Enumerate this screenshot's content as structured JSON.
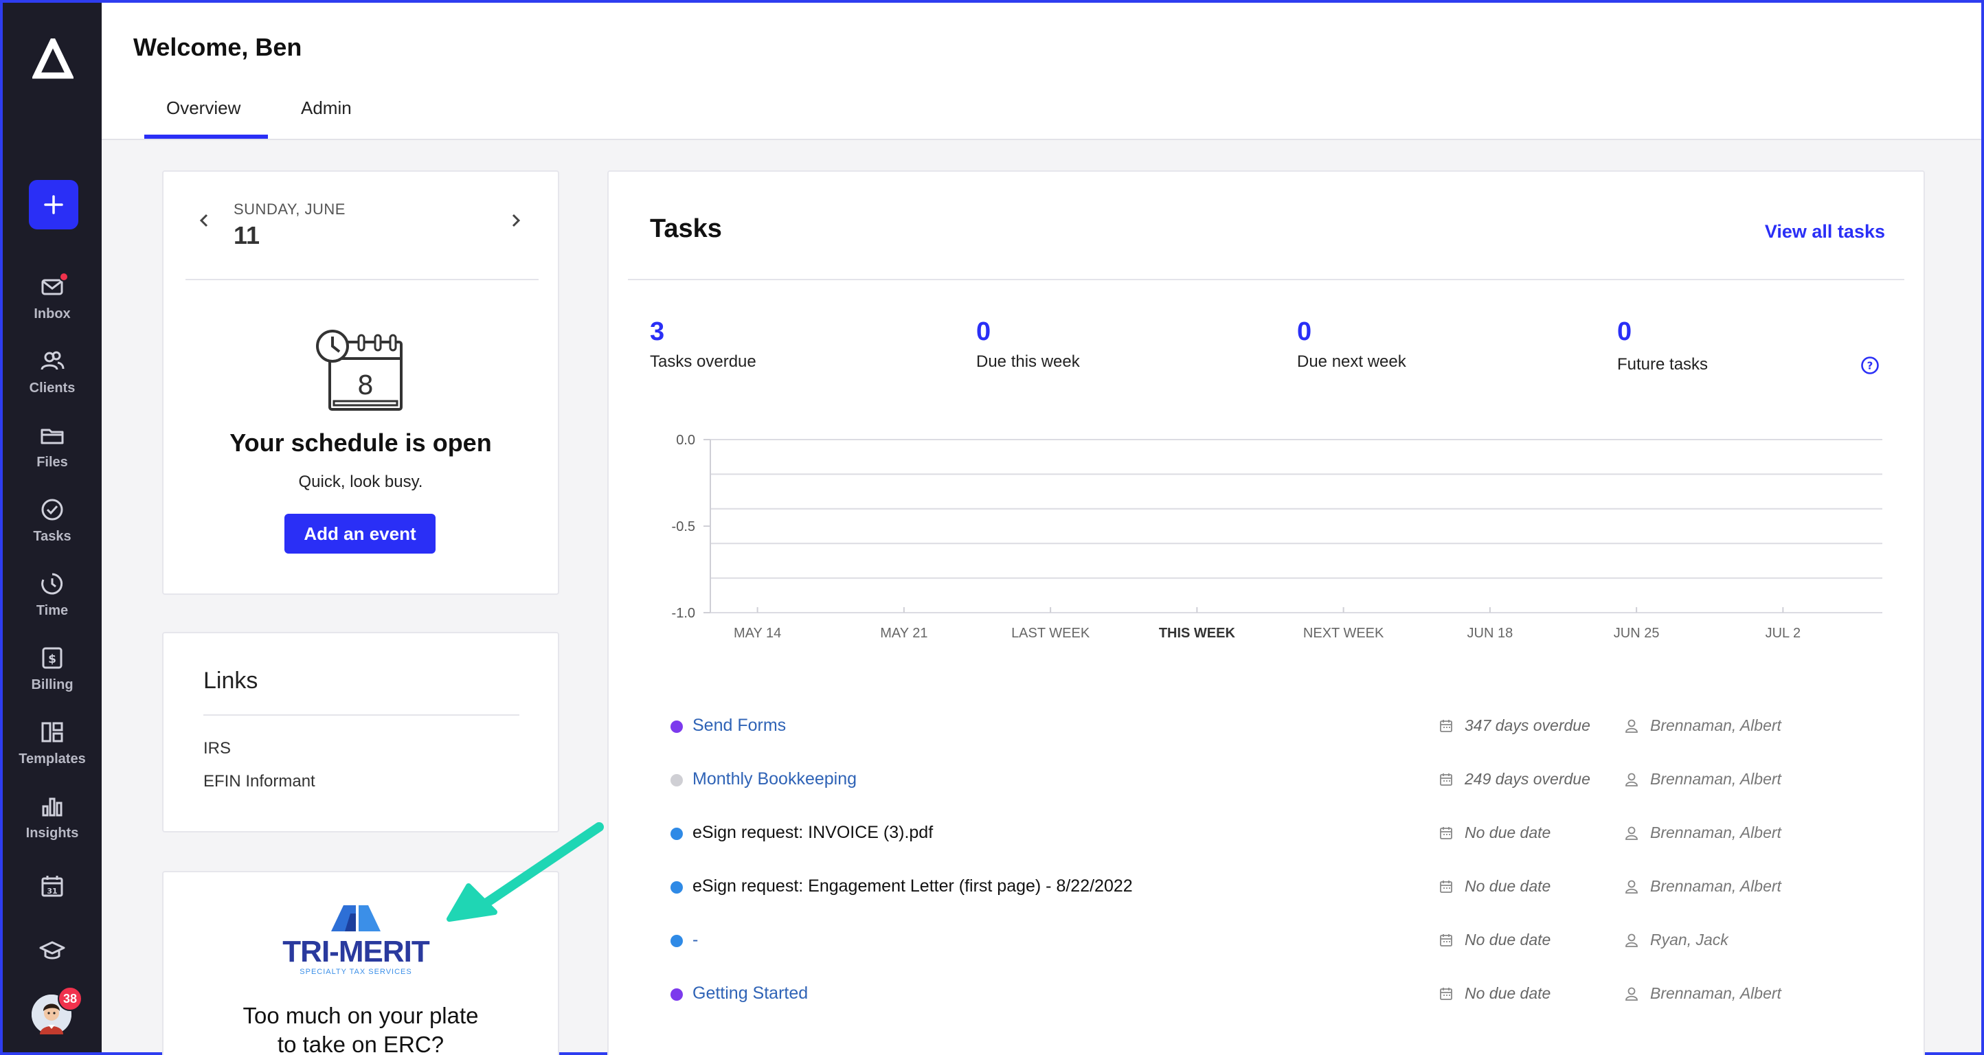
{
  "sidebar": {
    "items": [
      {
        "label": "Inbox",
        "icon": "inbox-icon"
      },
      {
        "label": "Clients",
        "icon": "clients-icon"
      },
      {
        "label": "Files",
        "icon": "folder-icon"
      },
      {
        "label": "Tasks",
        "icon": "check-circle-icon"
      },
      {
        "label": "Time",
        "icon": "clock-icon"
      },
      {
        "label": "Billing",
        "icon": "billing-icon"
      },
      {
        "label": "Templates",
        "icon": "templates-icon"
      },
      {
        "label": "Insights",
        "icon": "bar-chart-icon"
      }
    ],
    "avatar_badge": "38",
    "accent": "#2a2ff6",
    "background": "#1c1c28"
  },
  "header": {
    "title": "Welcome, Ben",
    "tabs": [
      {
        "label": "Overview",
        "active": true
      },
      {
        "label": "Admin",
        "active": false
      }
    ]
  },
  "calendar": {
    "weekday_month": "SUNDAY, JUNE",
    "day": "11",
    "icon_date": "8",
    "heading": "Your schedule is open",
    "subtext": "Quick, look busy.",
    "button": "Add an event"
  },
  "links": {
    "title": "Links",
    "items": [
      "IRS",
      "EFIN Informant"
    ]
  },
  "promo": {
    "logo_text": "TRI-MERIT",
    "logo_subtext": "SPECIALTY TAX SERVICES",
    "text_line1": "Too much on your plate",
    "text_line2": "to take on ERC?"
  },
  "tasks": {
    "title": "Tasks",
    "view_all": "View all tasks",
    "stats": [
      {
        "value": "3",
        "label": "Tasks overdue"
      },
      {
        "value": "0",
        "label": "Due this week"
      },
      {
        "value": "0",
        "label": "Due next week"
      },
      {
        "value": "0",
        "label": "Future tasks"
      }
    ],
    "list": [
      {
        "name": "Send Forms",
        "due": "347 days overdue",
        "assignee": "Brennaman, Albert",
        "dot_color": "#7c3aed",
        "linked": true
      },
      {
        "name": "Monthly Bookkeeping",
        "due": "249 days overdue",
        "assignee": "Brennaman, Albert",
        "dot_color": "#cfcfd4",
        "linked": true
      },
      {
        "name": "eSign request: INVOICE (3).pdf",
        "due": "No due date",
        "assignee": "Brennaman, Albert",
        "dot_color": "#2f8ae6",
        "linked": false
      },
      {
        "name": "eSign request: Engagement Letter (first page) - 8/22/2022",
        "due": "No due date",
        "assignee": "Brennaman, Albert",
        "dot_color": "#2f8ae6",
        "linked": false
      },
      {
        "name": "-",
        "due": "No due date",
        "assignee": "Ryan, Jack",
        "dot_color": "#2f8ae6",
        "linked": true
      },
      {
        "name": "Getting Started",
        "due": "No due date",
        "assignee": "Brennaman, Albert",
        "dot_color": "#7c3aed",
        "linked": true
      }
    ]
  },
  "chart_data": {
    "type": "line",
    "categories": [
      "MAY 14",
      "MAY 21",
      "LAST WEEK",
      "THIS WEEK",
      "NEXT WEEK",
      "JUN 18",
      "JUN 25",
      "JUL 2"
    ],
    "highlight_category": "THIS WEEK",
    "yticks": [
      "0.0",
      "-0.5",
      "-1.0"
    ],
    "ylim": [
      -1.0,
      0.0
    ],
    "grid": true,
    "series": []
  }
}
